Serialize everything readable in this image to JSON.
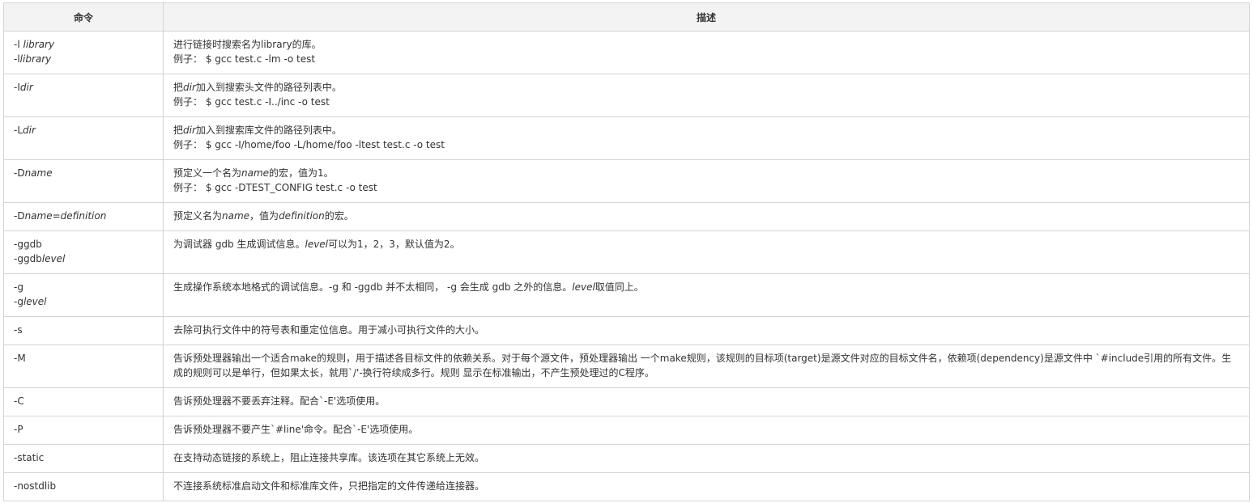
{
  "table": {
    "headers": [
      "命令",
      "描述"
    ],
    "rows": [
      {
        "cmd": [
          [
            "-l ",
            {
              "i": "library"
            }
          ],
          [
            "-l",
            {
              "i": "library"
            }
          ]
        ],
        "desc": [
          [
            "进行链接时搜索名为library的库。"
          ],
          [
            "例子： $ gcc test.c -lm -o test"
          ]
        ]
      },
      {
        "cmd": [
          [
            "-I",
            {
              "i": "dir"
            }
          ]
        ],
        "desc": [
          [
            "把",
            {
              "i": "dir"
            },
            "加入到搜索头文件的路径列表中。"
          ],
          [
            "例子： $ gcc test.c -I../inc -o test"
          ]
        ]
      },
      {
        "cmd": [
          [
            "-L",
            {
              "i": "dir"
            }
          ]
        ],
        "desc": [
          [
            "把",
            {
              "i": "dir"
            },
            "加入到搜索库文件的路径列表中。"
          ],
          [
            "例子： $ gcc -I/home/foo -L/home/foo -ltest test.c -o test"
          ]
        ]
      },
      {
        "cmd": [
          [
            "-D",
            {
              "i": "name"
            }
          ]
        ],
        "desc": [
          [
            "预定义一个名为",
            {
              "i": "name"
            },
            "的宏，值为1。"
          ],
          [
            "例子： $ gcc -DTEST_CONFIG test.c -o test"
          ]
        ]
      },
      {
        "cmd": [
          [
            "-D",
            {
              "i": "name=definition"
            }
          ]
        ],
        "desc": [
          [
            "预定义名为",
            {
              "i": "name"
            },
            "，值为",
            {
              "i": "definition"
            },
            "的宏。"
          ]
        ]
      },
      {
        "cmd": [
          [
            "-ggdb"
          ],
          [
            "-ggdb",
            {
              "i": "level"
            }
          ]
        ],
        "desc": [
          [
            "为调试器 gdb 生成调试信息。",
            {
              "i": "level"
            },
            "可以为1，2，3，默认值为2。"
          ]
        ]
      },
      {
        "cmd": [
          [
            "-g"
          ],
          [
            "-g",
            {
              "i": "level"
            }
          ]
        ],
        "desc": [
          [
            "生成操作系统本地格式的调试信息。-g 和 -ggdb 并不太相同， -g 会生成 gdb 之外的信息。",
            {
              "i": "level"
            },
            "取值同上。"
          ]
        ]
      },
      {
        "cmd": [
          [
            "-s"
          ]
        ],
        "desc": [
          [
            "去除可执行文件中的符号表和重定位信息。用于减小可执行文件的大小。"
          ]
        ]
      },
      {
        "cmd": [
          [
            "-M"
          ]
        ],
        "desc": [
          [
            "告诉预处理器输出一个适合make的规则，用于描述各目标文件的依赖关系。对于每个源文件，预处理器输出 一个make规则，该规则的目标项(target)是源文件对应的目标文件名，依赖项(dependency)是源文件中 `#include引用的所有文件。生成的规则可以是单行，但如果太长，就用`/'-换行符续成多行。规则 显示在标准输出，不产生预处理过的C程序。"
          ]
        ]
      },
      {
        "cmd": [
          [
            "-C"
          ]
        ],
        "desc": [
          [
            "告诉预处理器不要丢弃注释。配合`-E'选项使用。"
          ]
        ]
      },
      {
        "cmd": [
          [
            "-P"
          ]
        ],
        "desc": [
          [
            "告诉预处理器不要产生`#line'命令。配合`-E'选项使用。"
          ]
        ]
      },
      {
        "cmd": [
          [
            "-static"
          ]
        ],
        "desc": [
          [
            "在支持动态链接的系统上，阻止连接共享库。该选项在其它系统上无效。"
          ]
        ]
      },
      {
        "cmd": [
          [
            "-nostdlib"
          ]
        ],
        "desc": [
          [
            "不连接系统标准启动文件和标准库文件，只把指定的文件传递给连接器。"
          ]
        ]
      }
    ]
  }
}
